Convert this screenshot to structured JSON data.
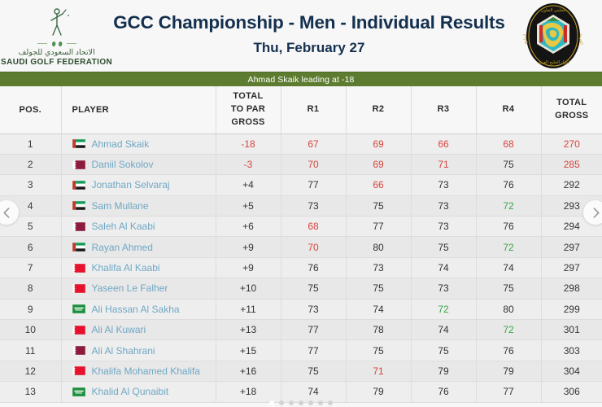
{
  "header": {
    "title": "GCC Championship - Men - Individual Results",
    "subtitle": "Thu, February 27",
    "left_logo": {
      "arabic": "الاتحاد السعودي للجولف",
      "english": "SAUDI GOLF FEDERATION"
    },
    "right_logo_name": "gcc-emblem"
  },
  "banner": {
    "text": "Ahmad Skaik leading at -18",
    "color": "#5d7c2f"
  },
  "table": {
    "columns": {
      "pos": "POS.",
      "player": "PLAYER",
      "total_to_par_gross": [
        "TOTAL",
        "TO PAR",
        "GROSS"
      ],
      "r1": "R1",
      "r2": "R2",
      "r3": "R3",
      "r4": "R4",
      "total_gross": [
        "TOTAL",
        "GROSS"
      ]
    },
    "colors": {
      "under_par": "#d9443c",
      "par_or_green": "#3aa647",
      "default": "#333333",
      "player_name": "#6fa8c4"
    },
    "rows": [
      {
        "pos": "1",
        "flag": "uae",
        "player": "Ahmad Skaik",
        "par": "-18",
        "par_color": "red",
        "r1": "67",
        "r1_color": "red",
        "r2": "69",
        "r2_color": "red",
        "r3": "66",
        "r3_color": "red",
        "r4": "68",
        "r4_color": "red",
        "total": "270",
        "total_color": "red"
      },
      {
        "pos": "2",
        "flag": "qatar",
        "player": "Daniil Sokolov",
        "par": "-3",
        "par_color": "red",
        "r1": "70",
        "r1_color": "red",
        "r2": "69",
        "r2_color": "red",
        "r3": "71",
        "r3_color": "red",
        "r4": "75",
        "r4_color": "dark",
        "total": "285",
        "total_color": "red"
      },
      {
        "pos": "3",
        "flag": "uae",
        "player": "Jonathan Selvaraj",
        "par": "+4",
        "par_color": "dark",
        "r1": "77",
        "r1_color": "dark",
        "r2": "66",
        "r2_color": "red",
        "r3": "73",
        "r3_color": "dark",
        "r4": "76",
        "r4_color": "dark",
        "total": "292",
        "total_color": "dark"
      },
      {
        "pos": "4",
        "flag": "uae",
        "player": "Sam Mullane",
        "par": "+5",
        "par_color": "dark",
        "r1": "73",
        "r1_color": "dark",
        "r2": "75",
        "r2_color": "dark",
        "r3": "73",
        "r3_color": "dark",
        "r4": "72",
        "r4_color": "green",
        "total": "293",
        "total_color": "dark"
      },
      {
        "pos": "5",
        "flag": "qatar",
        "player": "Saleh Al Kaabi",
        "par": "+6",
        "par_color": "dark",
        "r1": "68",
        "r1_color": "red",
        "r2": "77",
        "r2_color": "dark",
        "r3": "73",
        "r3_color": "dark",
        "r4": "76",
        "r4_color": "dark",
        "total": "294",
        "total_color": "dark"
      },
      {
        "pos": "6",
        "flag": "uae",
        "player": "Rayan Ahmed",
        "par": "+9",
        "par_color": "dark",
        "r1": "70",
        "r1_color": "red",
        "r2": "80",
        "r2_color": "dark",
        "r3": "75",
        "r3_color": "dark",
        "r4": "72",
        "r4_color": "green",
        "total": "297",
        "total_color": "dark"
      },
      {
        "pos": "7",
        "flag": "bahrain",
        "player": "Khalifa Al Kaabi",
        "par": "+9",
        "par_color": "dark",
        "r1": "76",
        "r1_color": "dark",
        "r2": "73",
        "r2_color": "dark",
        "r3": "74",
        "r3_color": "dark",
        "r4": "74",
        "r4_color": "dark",
        "total": "297",
        "total_color": "dark"
      },
      {
        "pos": "8",
        "flag": "bahrain",
        "player": "Yaseen Le Falher",
        "par": "+10",
        "par_color": "dark",
        "r1": "75",
        "r1_color": "dark",
        "r2": "75",
        "r2_color": "dark",
        "r3": "73",
        "r3_color": "dark",
        "r4": "75",
        "r4_color": "dark",
        "total": "298",
        "total_color": "dark"
      },
      {
        "pos": "9",
        "flag": "saudi",
        "player": "Ali Hassan Al Sakha",
        "par": "+11",
        "par_color": "dark",
        "r1": "73",
        "r1_color": "dark",
        "r2": "74",
        "r2_color": "dark",
        "r3": "72",
        "r3_color": "green",
        "r4": "80",
        "r4_color": "dark",
        "total": "299",
        "total_color": "dark"
      },
      {
        "pos": "10",
        "flag": "bahrain",
        "player": "Ali Al Kuwari",
        "par": "+13",
        "par_color": "dark",
        "r1": "77",
        "r1_color": "dark",
        "r2": "78",
        "r2_color": "dark",
        "r3": "74",
        "r3_color": "dark",
        "r4": "72",
        "r4_color": "green",
        "total": "301",
        "total_color": "dark"
      },
      {
        "pos": "11",
        "flag": "qatar",
        "player": "Ali Al Shahrani",
        "par": "+15",
        "par_color": "dark",
        "r1": "77",
        "r1_color": "dark",
        "r2": "75",
        "r2_color": "dark",
        "r3": "75",
        "r3_color": "dark",
        "r4": "76",
        "r4_color": "dark",
        "total": "303",
        "total_color": "dark"
      },
      {
        "pos": "12",
        "flag": "bahrain",
        "player": "Khalifa Mohamed Khalifa",
        "par": "+16",
        "par_color": "dark",
        "r1": "75",
        "r1_color": "dark",
        "r2": "71",
        "r2_color": "red",
        "r3": "79",
        "r3_color": "dark",
        "r4": "79",
        "r4_color": "dark",
        "total": "304",
        "total_color": "dark"
      },
      {
        "pos": "13",
        "flag": "saudi",
        "player": "Khalid Al Qunaibit",
        "par": "+18",
        "par_color": "dark",
        "r1": "74",
        "r1_color": "dark",
        "r2": "79",
        "r2_color": "dark",
        "r3": "76",
        "r3_color": "dark",
        "r4": "77",
        "r4_color": "dark",
        "total": "306",
        "total_color": "dark"
      }
    ]
  },
  "nav": {
    "prev": "prev-page",
    "next": "next-page"
  },
  "pagination": {
    "total_dots": 7,
    "active_index": 0
  }
}
